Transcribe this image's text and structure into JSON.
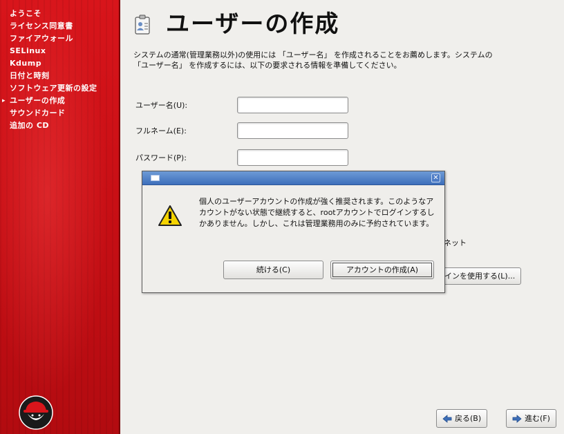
{
  "sidebar": {
    "items": [
      {
        "label": "ようこそ"
      },
      {
        "label": "ライセンス同意書"
      },
      {
        "label": "ファイアウォール"
      },
      {
        "label": "SELinux"
      },
      {
        "label": "Kdump"
      },
      {
        "label": "日付と時刻"
      },
      {
        "label": "ソフトウェア更新の設定"
      },
      {
        "label": "ユーザーの作成",
        "current": true
      },
      {
        "label": "サウンドカード"
      },
      {
        "label": "追加の CD"
      }
    ],
    "logo": "redhat-shadowman-logo"
  },
  "main": {
    "title": "ユーザーの作成",
    "title_icon": "user-card-icon",
    "intro": "システムの通常(管理業務以外)の使用には 「ユーザー名」 を作成されることをお薦めします。システムの 「ユーザー名」 を作成するには、以下の要求される情報を準備してください。",
    "fields": {
      "username_label": "ユーザー名(U):",
      "username_value": "",
      "fullname_label": "フルネーム(E):",
      "fullname_value": "",
      "password_label": "パスワード(P):",
      "password_value": ""
    },
    "network_fragment": "ネット",
    "network_login_button": "インを使用する(L)..."
  },
  "dialog": {
    "titlebar": {
      "title": "",
      "menu_icon": "window-menu-icon",
      "close_icon": "window-close-icon",
      "color": "#4a7cc4"
    },
    "icon": "warning-icon",
    "message": "個人のユーザーアカウントの作成が強く推奨されます。このようなアカウントがない状態で継続すると、rootアカウントでログインするしかありません。しかし、これは管理業務用のみに予約されています。",
    "continue_button": "続ける(C)",
    "create_account_button": "アカウントの作成(A)"
  },
  "footer": {
    "back_button": "戻る(B)",
    "forward_button": "進む(F)"
  },
  "colors": {
    "sidebar_red": "#c90f15",
    "titlebar_blue": "#3d6fbb",
    "warning_yellow": "#f4d300"
  }
}
